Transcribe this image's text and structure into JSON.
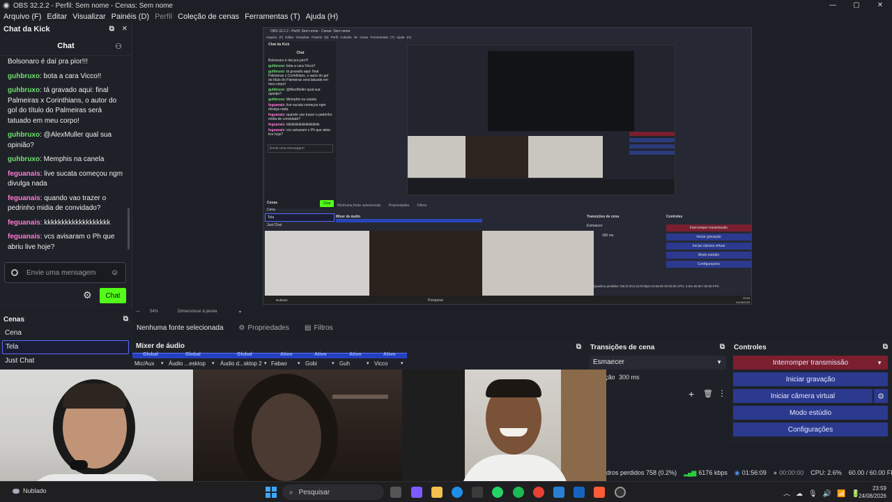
{
  "window": {
    "title": "OBS 32.2.2 - Perfil: Sem nome - Cenas: Sem nome",
    "controls": [
      "—",
      "▢",
      "✕"
    ]
  },
  "menu": [
    {
      "label": "Arquivo (F)"
    },
    {
      "label": "Editar"
    },
    {
      "label": "Visualizar"
    },
    {
      "label": "Painéis (D)"
    },
    {
      "label": "Perfil"
    },
    {
      "label": "Coleção de cenas"
    },
    {
      "label": "Ferramentas (T)"
    },
    {
      "label": "Ajuda (H)"
    }
  ],
  "chat_dock": {
    "dock_title": "Chat da Kick",
    "header": "Chat",
    "messages": [
      {
        "user": "",
        "text": "Bolsonaro é daí pra pior!!!",
        "color": "#ffffff"
      },
      {
        "user": "guhbruxo",
        "text": ": bota a cara Vicco!!",
        "color": "#6fe06f"
      },
      {
        "user": "guhbruxo",
        "text": ": tá gravado aqui: final Palmeiras x Corinthians, o autor do gol do título do Palmeiras será tatuado em meu corpo!",
        "color": "#6fe06f"
      },
      {
        "user": "guhbruxo",
        "text": ": @AlexMuller qual sua opinião?",
        "color": "#6fe06f"
      },
      {
        "user": "guhbruxo",
        "text": ": Memphis na canela",
        "color": "#6fe06f"
      },
      {
        "user": "feguanais",
        "text": ": live sucata começou ngm divulga nada",
        "color": "#ff7bd4"
      },
      {
        "user": "feguanais",
        "text": ": quando vao trazer o pedrinho midia de convidado?",
        "color": "#ff7bd4"
      },
      {
        "user": "feguanais",
        "text": ": kkkkkkkkkkkkkkkkkkk",
        "color": "#ff7bd4"
      },
      {
        "user": "feguanais",
        "text": ": vcs avisaram o Ph que abriu live hoje?",
        "color": "#ff7bd4"
      }
    ],
    "input_placeholder": "Envie uma mensagem",
    "send_label": "Chat"
  },
  "nested": {
    "dock_title": "Chat da Kick",
    "header": "Chat",
    "lines": [
      {
        "user": "",
        "text": "Bolsonaro é daí pra pior!!!"
      },
      {
        "user": "guhbruxo",
        "text": ": bota a cara Vicco!!"
      },
      {
        "user": "guhbruxo",
        "text": ": tá gravado aqui: final Palmeiras x Corinthians, o autor do gol do título do Palmeiras será tatuado em meu corpo!"
      },
      {
        "user": "guhbruxo",
        "text": ": @AlexMuller qual sua opinião?"
      },
      {
        "user": "guhbruxo",
        "text": ": Memphis na canela"
      },
      {
        "user": "feguanais",
        "text": ": live sucata começou ngm divulga nada"
      },
      {
        "user": "feguanais",
        "text": ": quando vao trazer o pedrinho mídia de convidado?"
      },
      {
        "user": "feguanais",
        "text": ": kkkkkkkkkkkkkkkkkkk"
      },
      {
        "user": "feguanais",
        "text": ": vcs avisaram o Ph que abriu live hoje?"
      }
    ],
    "input_placeholder": "Envie uma mensagem",
    "send_label": "Chat",
    "scenes_title": "Cenas",
    "scenes": [
      "Cena",
      "Tela",
      "Just Chat"
    ],
    "mixer_title": "Mixer de áudio",
    "no_source": "Nenhuma fonte selecionada",
    "props": "Propriedades",
    "filters": "Filtros",
    "transitions_title": "Transições de cena",
    "transition": "Esmaecer",
    "duration": "300 ms",
    "controls_title": "Controles",
    "controls": [
      "Interromper transmissão",
      "Iniciar gravação",
      "Iniciar câmera virtual",
      "Modo estúdio",
      "Configurações"
    ],
    "status": "Quadros perdidos 758 (0.2%)   6176 kbps   01:56:09   00:00:00   CPU: 2.6%   60.00 / 60.00 FPS",
    "weather": "Nublado",
    "search": "Pesquisar",
    "clock": "23:59",
    "date": "24/08/2026"
  },
  "zoom": {
    "value": "54%",
    "resize": "Dimensionar à janela"
  },
  "source_toolbar": {
    "none_selected": "Nenhuma fonte selecionada",
    "properties": "Propriedades",
    "filters": "Filtros"
  },
  "scenes": {
    "title": "Cenas",
    "items": [
      {
        "label": "Cena",
        "selected": false
      },
      {
        "label": "Tela",
        "selected": true
      },
      {
        "label": "Just Chat",
        "selected": false
      }
    ]
  },
  "mixer": {
    "title": "Mixer de áudio",
    "headers": [
      "Global",
      "Global",
      "Global",
      "Ativo",
      "Ativo",
      "Ativo",
      "Ativo"
    ],
    "channels": [
      "Mic/Aux",
      "Áudio ...esktop",
      "Áudio d...sktop 2",
      "Fabao",
      "Gobi",
      "Guh",
      "Vicco"
    ]
  },
  "transitions": {
    "title": "Transições de cena",
    "selected": "Esmaecer",
    "duration_label": "ção",
    "duration": "300 ms"
  },
  "controls": {
    "title": "Controles",
    "stop_stream": "Interromper transmissão",
    "start_record": "Iniciar gravação",
    "virtual_cam": "Iniciar câmera virtual",
    "studio_mode": "Modo estúdio",
    "settings": "Configurações"
  },
  "status_bar": {
    "dropped": "dros perdidos 758 (0.2%)",
    "bitrate": "6176 kbps",
    "stream_time": "01:56:09",
    "record_time": "00:00:00",
    "cpu": "CPU: 2.6%",
    "fps": "60.00 / 60.00 FPS"
  },
  "taskbar": {
    "weather": "Nublado",
    "search": "Pesquisar",
    "time": "23:59",
    "date": "24/08/2026"
  },
  "colors": {
    "kick_green": "#53fc18",
    "accent_blue": "#2b3a8f",
    "stream_red": "#7b1e2e",
    "user_green": "#6fe06f",
    "user_pink": "#ff7bd4"
  }
}
